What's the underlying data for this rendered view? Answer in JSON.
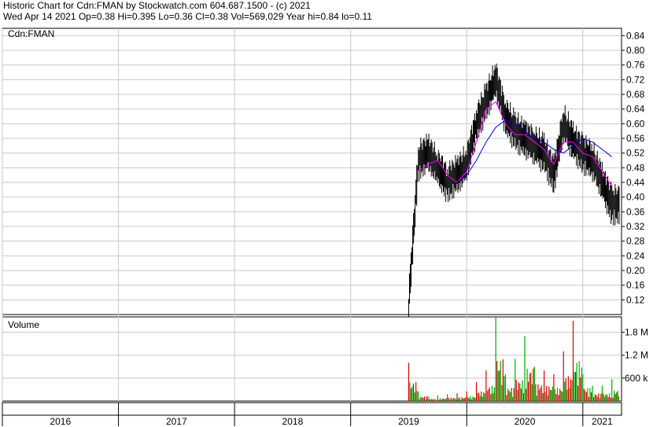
{
  "header": {
    "line1": "Historic Chart for Cdn:FMAN by Stockwatch.com 604.687.1500 - (c) 2021",
    "line2": "Wed Apr 14 2021   Op=0.38   Hi=0.395   Lo=0.36   Cl=0.38   Vol=569,029   Year hi=0.84   lo=0.11"
  },
  "colors": {
    "background": "#ffffff",
    "grid": "#c8c8c8",
    "price_bar": "#000000",
    "ma_short": "#ff00ff",
    "ma_long": "#0000cc",
    "gap_tick": "#cc0000",
    "volume_up": "#00aa00",
    "volume_down": "#dd0000"
  },
  "chart_data": [
    {
      "type": "line",
      "panel": "price",
      "title": "Cdn:FMAN",
      "ylim": [
        0.08,
        0.86
      ],
      "yticks": [
        "0.84",
        "0.80",
        "0.76",
        "0.72",
        "0.68",
        "0.64",
        "0.60",
        "0.56",
        "0.52",
        "0.48",
        "0.44",
        "0.40",
        "0.36",
        "0.32",
        "0.28",
        "0.24",
        "0.20",
        "0.16",
        "0.12"
      ],
      "grid": true,
      "xlim": [
        "2016-01",
        "2021-05"
      ],
      "series": [
        {
          "kind": "close",
          "x": [
            "2019-07",
            "2019-08",
            "2019-09",
            "2019-10",
            "2019-11",
            "2019-12",
            "2020-01",
            "2020-02",
            "2020-03",
            "2020-04",
            "2020-05",
            "2020-06",
            "2020-07",
            "2020-08",
            "2020-09",
            "2020-10",
            "2020-11",
            "2020-12",
            "2021-01",
            "2021-02",
            "2021-03",
            "2021-04"
          ],
          "values": [
            0.11,
            0.5,
            0.52,
            0.48,
            0.44,
            0.46,
            0.49,
            0.6,
            0.66,
            0.72,
            0.62,
            0.58,
            0.56,
            0.54,
            0.52,
            0.46,
            0.6,
            0.55,
            0.52,
            0.5,
            0.44,
            0.38
          ]
        },
        {
          "kind": "ma_short",
          "x": [
            "2019-08",
            "2019-09",
            "2019-10",
            "2019-11",
            "2019-12",
            "2020-01",
            "2020-02",
            "2020-03",
            "2020-04",
            "2020-05",
            "2020-06",
            "2020-07",
            "2020-08",
            "2020-09",
            "2020-10",
            "2020-11",
            "2020-12",
            "2021-01",
            "2021-02",
            "2021-03",
            "2021-04"
          ],
          "values": [
            0.47,
            0.49,
            0.5,
            0.46,
            0.44,
            0.47,
            0.55,
            0.64,
            0.66,
            0.6,
            0.57,
            0.57,
            0.55,
            0.53,
            0.49,
            0.55,
            0.55,
            0.52,
            0.51,
            0.47,
            0.43
          ]
        },
        {
          "kind": "ma_long",
          "x": [
            "2019-12",
            "2020-01",
            "2020-02",
            "2020-03",
            "2020-04",
            "2020-05",
            "2020-06",
            "2020-07",
            "2020-08",
            "2020-09",
            "2020-10",
            "2020-11",
            "2020-12",
            "2021-01",
            "2021-02",
            "2021-03",
            "2021-04"
          ],
          "values": [
            0.44,
            0.46,
            0.5,
            0.55,
            0.59,
            0.61,
            0.6,
            0.58,
            0.56,
            0.55,
            0.53,
            0.52,
            0.54,
            0.56,
            0.55,
            0.53,
            0.51
          ]
        }
      ]
    },
    {
      "type": "bar",
      "panel": "volume",
      "title": "Volume",
      "ylim": [
        0,
        2200000
      ],
      "yticks": [
        {
          "value": 1800000,
          "label": "1.8 M"
        },
        {
          "value": 1200000,
          "label": "1.2 M"
        },
        {
          "value": 600000,
          "label": "600 k"
        }
      ],
      "x": [
        "2019-07",
        "2019-08",
        "2019-09",
        "2019-10",
        "2019-11",
        "2019-12",
        "2020-01",
        "2020-02",
        "2020-03",
        "2020-04",
        "2020-05",
        "2020-06",
        "2020-07",
        "2020-08",
        "2020-09",
        "2020-10",
        "2020-11",
        "2020-12",
        "2021-01",
        "2021-02",
        "2021-03",
        "2021-04"
      ],
      "values": [
        1000000,
        250000,
        120000,
        150000,
        180000,
        200000,
        250000,
        500000,
        800000,
        2200000,
        700000,
        1100000,
        1700000,
        900000,
        800000,
        700000,
        1300000,
        2100000,
        700000,
        400000,
        400000,
        569029
      ]
    }
  ],
  "x_axis": {
    "labels": [
      "2016",
      "2017",
      "2018",
      "2019",
      "2020",
      "2021"
    ]
  }
}
